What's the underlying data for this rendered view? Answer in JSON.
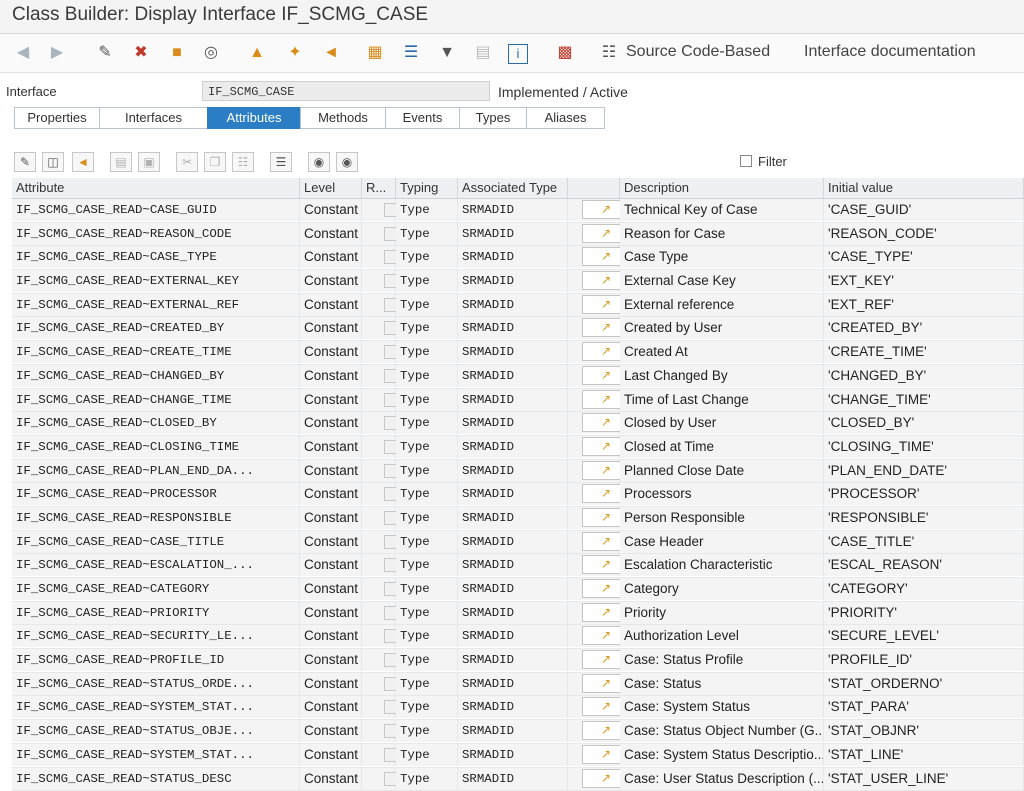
{
  "window": {
    "title": "Class Builder: Display Interface IF_SCMG_CASE"
  },
  "toolbar": {
    "source_code_label": "Source Code-Based",
    "interface_doc_label": "Interface documentation"
  },
  "interface": {
    "label": "Interface",
    "value": "IF_SCMG_CASE",
    "status": "Implemented / Active"
  },
  "tabs": [
    {
      "label": "Properties"
    },
    {
      "label": "Interfaces"
    },
    {
      "label": "Attributes"
    },
    {
      "label": "Methods"
    },
    {
      "label": "Events"
    },
    {
      "label": "Types"
    },
    {
      "label": "Aliases"
    }
  ],
  "active_tab": "Attributes",
  "filter": {
    "label": "Filter",
    "checked": false
  },
  "table": {
    "columns": {
      "attribute": "Attribute",
      "level": "Level",
      "readonly": "R...",
      "typing": "Typing",
      "assoc_type": "Associated Type",
      "description": "Description",
      "initial": "Initial value"
    },
    "rows": [
      {
        "attribute": "IF_SCMG_CASE_READ~CASE_GUID",
        "level": "Constant",
        "typing": "Type",
        "assoc": "SRMADID",
        "description": "Technical Key of Case",
        "initial": "'CASE_GUID'"
      },
      {
        "attribute": "IF_SCMG_CASE_READ~REASON_CODE",
        "level": "Constant",
        "typing": "Type",
        "assoc": "SRMADID",
        "description": "Reason for Case",
        "initial": "'REASON_CODE'"
      },
      {
        "attribute": "IF_SCMG_CASE_READ~CASE_TYPE",
        "level": "Constant",
        "typing": "Type",
        "assoc": "SRMADID",
        "description": "Case Type",
        "initial": "'CASE_TYPE'"
      },
      {
        "attribute": "IF_SCMG_CASE_READ~EXTERNAL_KEY",
        "level": "Constant",
        "typing": "Type",
        "assoc": "SRMADID",
        "description": "External Case Key",
        "initial": "'EXT_KEY'"
      },
      {
        "attribute": "IF_SCMG_CASE_READ~EXTERNAL_REF",
        "level": "Constant",
        "typing": "Type",
        "assoc": "SRMADID",
        "description": "External reference",
        "initial": "'EXT_REF'"
      },
      {
        "attribute": "IF_SCMG_CASE_READ~CREATED_BY",
        "level": "Constant",
        "typing": "Type",
        "assoc": "SRMADID",
        "description": "Created by User",
        "initial": "'CREATED_BY'"
      },
      {
        "attribute": "IF_SCMG_CASE_READ~CREATE_TIME",
        "level": "Constant",
        "typing": "Type",
        "assoc": "SRMADID",
        "description": "Created At",
        "initial": "'CREATE_TIME'"
      },
      {
        "attribute": "IF_SCMG_CASE_READ~CHANGED_BY",
        "level": "Constant",
        "typing": "Type",
        "assoc": "SRMADID",
        "description": "Last Changed By",
        "initial": "'CHANGED_BY'"
      },
      {
        "attribute": "IF_SCMG_CASE_READ~CHANGE_TIME",
        "level": "Constant",
        "typing": "Type",
        "assoc": "SRMADID",
        "description": "Time of Last Change",
        "initial": "'CHANGE_TIME'"
      },
      {
        "attribute": "IF_SCMG_CASE_READ~CLOSED_BY",
        "level": "Constant",
        "typing": "Type",
        "assoc": "SRMADID",
        "description": "Closed by User",
        "initial": "'CLOSED_BY'"
      },
      {
        "attribute": "IF_SCMG_CASE_READ~CLOSING_TIME",
        "level": "Constant",
        "typing": "Type",
        "assoc": "SRMADID",
        "description": "Closed at Time",
        "initial": "'CLOSING_TIME'"
      },
      {
        "attribute": "IF_SCMG_CASE_READ~PLAN_END_DA...",
        "level": "Constant",
        "typing": "Type",
        "assoc": "SRMADID",
        "description": "Planned Close Date",
        "initial": "'PLAN_END_DATE'"
      },
      {
        "attribute": "IF_SCMG_CASE_READ~PROCESSOR",
        "level": "Constant",
        "typing": "Type",
        "assoc": "SRMADID",
        "description": "Processors",
        "initial": "'PROCESSOR'"
      },
      {
        "attribute": "IF_SCMG_CASE_READ~RESPONSIBLE",
        "level": "Constant",
        "typing": "Type",
        "assoc": "SRMADID",
        "description": "Person Responsible",
        "initial": "'RESPONSIBLE'"
      },
      {
        "attribute": "IF_SCMG_CASE_READ~CASE_TITLE",
        "level": "Constant",
        "typing": "Type",
        "assoc": "SRMADID",
        "description": "Case Header",
        "initial": "'CASE_TITLE'"
      },
      {
        "attribute": "IF_SCMG_CASE_READ~ESCALATION_...",
        "level": "Constant",
        "typing": "Type",
        "assoc": "SRMADID",
        "description": "Escalation Characteristic",
        "initial": "'ESCAL_REASON'"
      },
      {
        "attribute": "IF_SCMG_CASE_READ~CATEGORY",
        "level": "Constant",
        "typing": "Type",
        "assoc": "SRMADID",
        "description": "Category",
        "initial": "'CATEGORY'"
      },
      {
        "attribute": "IF_SCMG_CASE_READ~PRIORITY",
        "level": "Constant",
        "typing": "Type",
        "assoc": "SRMADID",
        "description": "Priority",
        "initial": "'PRIORITY'"
      },
      {
        "attribute": "IF_SCMG_CASE_READ~SECURITY_LE...",
        "level": "Constant",
        "typing": "Type",
        "assoc": "SRMADID",
        "description": "Authorization Level",
        "initial": "'SECURE_LEVEL'"
      },
      {
        "attribute": "IF_SCMG_CASE_READ~PROFILE_ID",
        "level": "Constant",
        "typing": "Type",
        "assoc": "SRMADID",
        "description": "Case: Status Profile",
        "initial": "'PROFILE_ID'"
      },
      {
        "attribute": "IF_SCMG_CASE_READ~STATUS_ORDE...",
        "level": "Constant",
        "typing": "Type",
        "assoc": "SRMADID",
        "description": "Case: Status",
        "initial": "'STAT_ORDERNO'"
      },
      {
        "attribute": "IF_SCMG_CASE_READ~SYSTEM_STAT...",
        "level": "Constant",
        "typing": "Type",
        "assoc": "SRMADID",
        "description": "Case: System Status",
        "initial": "'STAT_PARA'"
      },
      {
        "attribute": "IF_SCMG_CASE_READ~STATUS_OBJE...",
        "level": "Constant",
        "typing": "Type",
        "assoc": "SRMADID",
        "description": "Case: Status Object Number (G...",
        "initial": "'STAT_OBJNR'"
      },
      {
        "attribute": "IF_SCMG_CASE_READ~SYSTEM_STAT...",
        "level": "Constant",
        "typing": "Type",
        "assoc": "SRMADID",
        "description": "Case: System Status Descriptio...",
        "initial": "'STAT_LINE'"
      },
      {
        "attribute": "IF_SCMG_CASE_READ~STATUS_DESC",
        "level": "Constant",
        "typing": "Type",
        "assoc": "SRMADID",
        "description": "Case: User Status Description (...",
        "initial": "'STAT_USER_LINE'"
      }
    ]
  }
}
